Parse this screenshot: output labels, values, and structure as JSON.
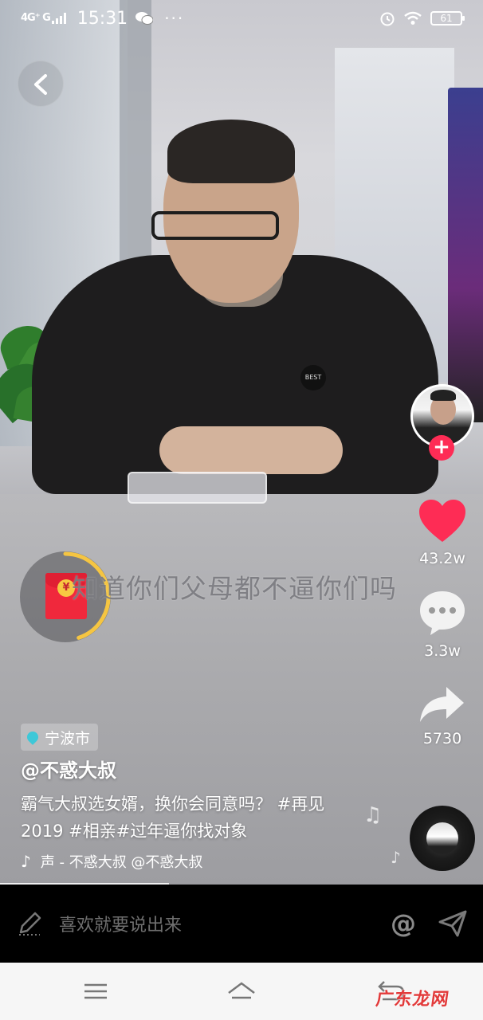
{
  "status_bar": {
    "network_label": "4G⁺ G",
    "time": "15:31",
    "overflow": "···",
    "battery": "61",
    "icons": [
      "signal-icon",
      "wechat-icon",
      "alarm-icon",
      "wifi-icon",
      "battery-icon"
    ]
  },
  "subtitle": "知道你们父母都不逼你们吗",
  "actions": {
    "likes": "43.2w",
    "comments": "3.3w",
    "shares": "5730"
  },
  "post": {
    "location": "宁波市",
    "author": "@不惑大叔",
    "description": "霸气大叔选女婿，换你会同意吗？ #再见2019 #相亲#过年逼你找对象",
    "music": "声 - 不惑大叔     @不惑大叔",
    "playback_progress": 0.35
  },
  "comment_bar": {
    "placeholder": "喜欢就要说出来",
    "mention_symbol": "@"
  },
  "red_packet": {
    "currency_symbol": "¥",
    "countdown_progress": 0.45
  },
  "watermark": "广东龙网",
  "colors": {
    "like": "#fe2c55",
    "follow": "#fe2c55",
    "location_pin": "#3ec8d8",
    "countdown_ring": "#f5c542",
    "packet_red": "#f0283c"
  }
}
